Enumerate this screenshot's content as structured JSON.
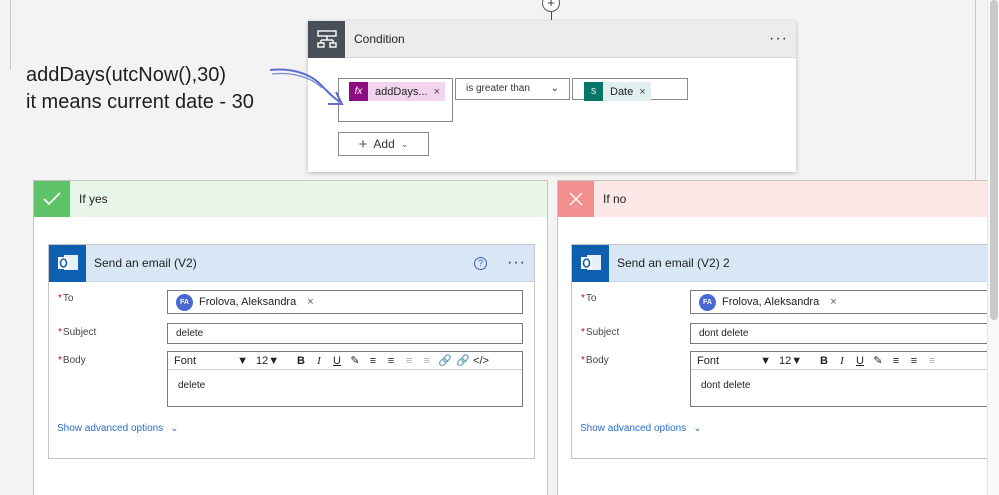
{
  "condition": {
    "title": "Condition",
    "more": "···",
    "left_token": {
      "label": "addDays...",
      "icon": "fx",
      "remove": "×",
      "color": "#8d0c83"
    },
    "operator": "is greater than",
    "right_token": {
      "label": "Date",
      "icon": "S",
      "remove": "×",
      "color": "#077568"
    },
    "add_label": "Add"
  },
  "annotation": {
    "line1": "addDays(utcNow(),30)",
    "line2": "it means current date - 30"
  },
  "yes_branch": {
    "label": "If yes",
    "color": "#5fc36a",
    "email": {
      "title": "Send an email (V2)",
      "help": "?",
      "more": "···",
      "to_label": "To",
      "to_person": "Frolova, Aleksandra",
      "to_initials": "FA",
      "subject_label": "Subject",
      "subject": "delete",
      "body_label": "Body",
      "font": "Font",
      "size": "12",
      "body": "delete",
      "advanced": "Show advanced options"
    }
  },
  "no_branch": {
    "label": "If no",
    "color": "#f08f8d",
    "email": {
      "title": "Send an email (V2) 2",
      "to_label": "To",
      "to_person": "Frolova, Aleksandra",
      "to_initials": "FA",
      "subject_label": "Subject",
      "subject": "dont delete",
      "body_label": "Body",
      "font": "Font",
      "size": "12",
      "body": "dont delete",
      "advanced": "Show advanced options"
    }
  },
  "required_marker": "*",
  "connector_plus": "+"
}
